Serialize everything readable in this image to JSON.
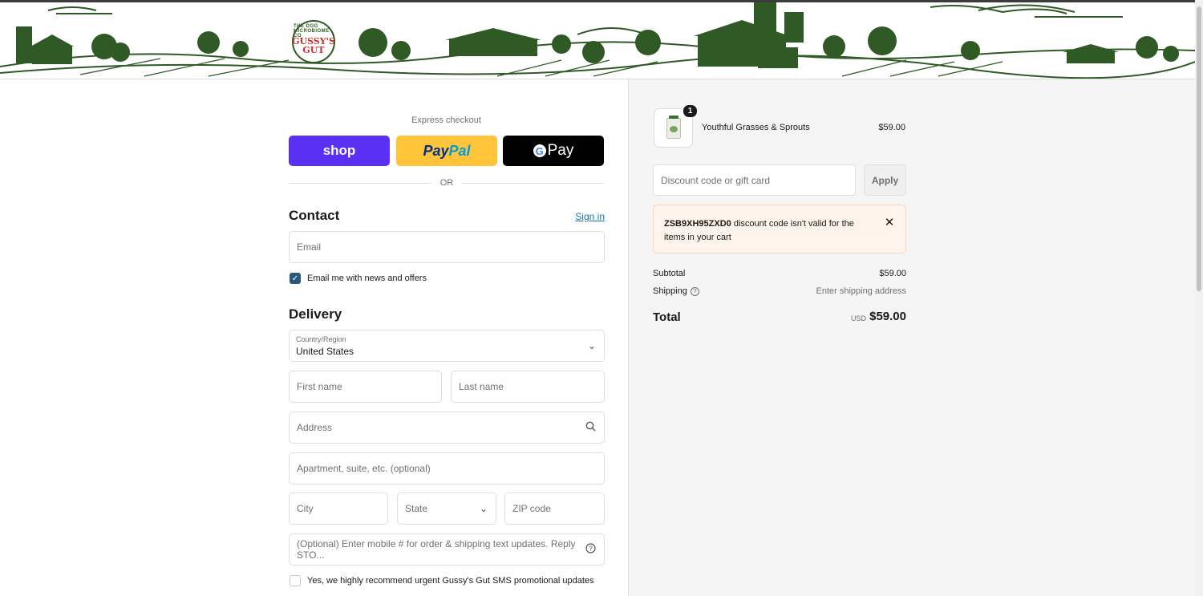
{
  "brand": {
    "logo_text": "GUSSY'S GUT",
    "logo_ring": "THE DOG MICROBIOME CO"
  },
  "express": {
    "label": "Express checkout",
    "shop": "shop",
    "paypal_a": "Pay",
    "paypal_b": "Pal",
    "gpay": "Pay",
    "gpay_g": "G",
    "or": "OR"
  },
  "contact": {
    "title": "Contact",
    "sign_in": "Sign in",
    "email_placeholder": "Email",
    "newsletter_label": "Email me with news and offers",
    "newsletter_checked": true
  },
  "delivery": {
    "title": "Delivery",
    "country_label": "Country/Region",
    "country_value": "United States",
    "first_name": "First name",
    "last_name": "Last name",
    "address": "Address",
    "apartment": "Apartment, suite, etc. (optional)",
    "city": "City",
    "state": "State",
    "zip": "ZIP code",
    "phone": "(Optional) Enter mobile # for order & shipping text updates. Reply STO...",
    "sms_label": "Yes, we highly recommend urgent Gussy's Gut SMS promotional updates",
    "sms_checked": false
  },
  "cart": {
    "items": [
      {
        "name": "Youthful Grasses & Sprouts",
        "price": "$59.00",
        "qty": "1"
      }
    ],
    "discount_placeholder": "Discount code or gift card",
    "apply": "Apply",
    "alert_code": "ZSB9XH95ZXD0",
    "alert_text": " discount code isn't valid for the items in your cart",
    "subtotal_label": "Subtotal",
    "subtotal_value": "$59.00",
    "shipping_label": "Shipping",
    "shipping_value": "Enter shipping address",
    "total_label": "Total",
    "total_currency": "USD",
    "total_value": "$59.00"
  },
  "colors": {
    "shop": "#5a31f4",
    "paypal": "#ffc439",
    "accent": "#1773b0",
    "checkbox": "#275a7a",
    "banner_ink": "#2f5a25"
  }
}
